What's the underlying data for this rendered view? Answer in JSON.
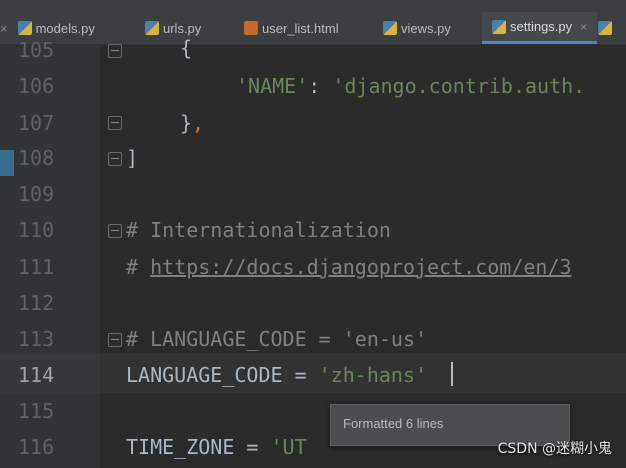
{
  "tabs": [
    {
      "label": "models.py",
      "icon": "python-file-icon"
    },
    {
      "label": "urls.py",
      "icon": "python-file-icon"
    },
    {
      "label": "user_list.html",
      "icon": "html-file-icon"
    },
    {
      "label": "views.py",
      "icon": "python-file-icon"
    },
    {
      "label": "settings.py",
      "icon": "python-file-icon",
      "active": true
    }
  ],
  "line_numbers": [
    "105",
    "106",
    "107",
    "108",
    "109",
    "110",
    "111",
    "112",
    "113",
    "114",
    "115",
    "116"
  ],
  "code": {
    "l105": "{",
    "l106_key": "'NAME'",
    "l106_colon": ": ",
    "l106_val": "'django.contrib.auth.",
    "l107_brace": "}",
    "l107_comma": ",",
    "l108": "]",
    "l110": "# Internationalization",
    "l111_hash": "# ",
    "l111_url": "https://docs.djangoproject.com/en/3",
    "l113": "# LANGUAGE_CODE = 'en-us'",
    "l114_name": "LANGUAGE_CODE = ",
    "l114_val": "'zh-hans'",
    "l116_name": "TIME_ZONE = ",
    "l116_val": "'UT"
  },
  "tooltip": "Formatted 6 lines",
  "watermark": "CSDN @迷糊小鬼",
  "colors": {
    "string": "#6a8759",
    "comment": "#808080",
    "keyword": "#cc7832",
    "text": "#a9b7c6",
    "background": "#2b2b2b"
  }
}
